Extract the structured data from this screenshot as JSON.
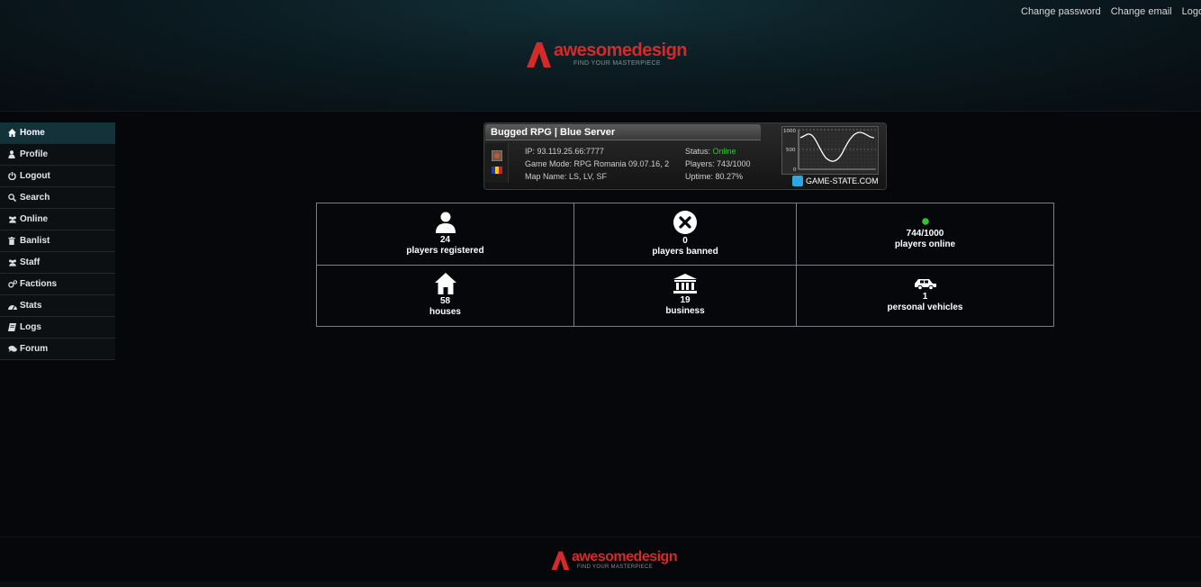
{
  "header": {
    "top_links": [
      "Change password",
      "Change email",
      "Logout"
    ],
    "logo": {
      "name": "awesomedesign",
      "tagline": "FIND YOUR MASTERPIECE"
    }
  },
  "sidebar": {
    "items": [
      {
        "label": "Home",
        "icon": "home-icon",
        "active": true
      },
      {
        "label": "Profile",
        "icon": "user-icon"
      },
      {
        "label": "Logout",
        "icon": "power-icon"
      },
      {
        "label": "Search",
        "icon": "search-icon"
      },
      {
        "label": "Online",
        "icon": "users-icon"
      },
      {
        "label": "Banlist",
        "icon": "trash-icon"
      },
      {
        "label": "Staff",
        "icon": "users-icon"
      },
      {
        "label": "Factions",
        "icon": "gears-icon"
      },
      {
        "label": "Stats",
        "icon": "dashboard-icon"
      },
      {
        "label": "Logs",
        "icon": "book-icon"
      },
      {
        "label": "Forum",
        "icon": "comments-icon"
      }
    ]
  },
  "server_banner": {
    "title": "Bugged RPG | Blue Server",
    "ip": "IP:  93.119.25.66:7777",
    "gamemode": "Game Mode: RPG Romania 09.07.16, 2",
    "map": "Map Name: LS, LV, SF",
    "status_label": "Status: ",
    "status_value": "Online",
    "players": "Players: 743/1000",
    "uptime": "Uptime: 80.27%",
    "graph_ticks": [
      "1000",
      "500",
      "0"
    ],
    "provider": "GAME-STATE.COM",
    "status_color": "#35c035"
  },
  "stats": [
    {
      "value": "24",
      "label": "players registered",
      "icon": "user-icon"
    },
    {
      "value": "0",
      "label": "players banned",
      "icon": "close-circle-icon"
    },
    {
      "value": "744/1000",
      "label": "players online",
      "icon": "online-dot-icon"
    },
    {
      "value": "58",
      "label": "houses",
      "icon": "house-icon"
    },
    {
      "value": "19",
      "label": "business",
      "icon": "bank-icon"
    },
    {
      "value": "1",
      "label": "personal vehicles",
      "icon": "car-icon"
    }
  ],
  "footer": {
    "logo_name": "awesomedesign",
    "logo_tagline": "FIND YOUR MASTERPIECE"
  }
}
